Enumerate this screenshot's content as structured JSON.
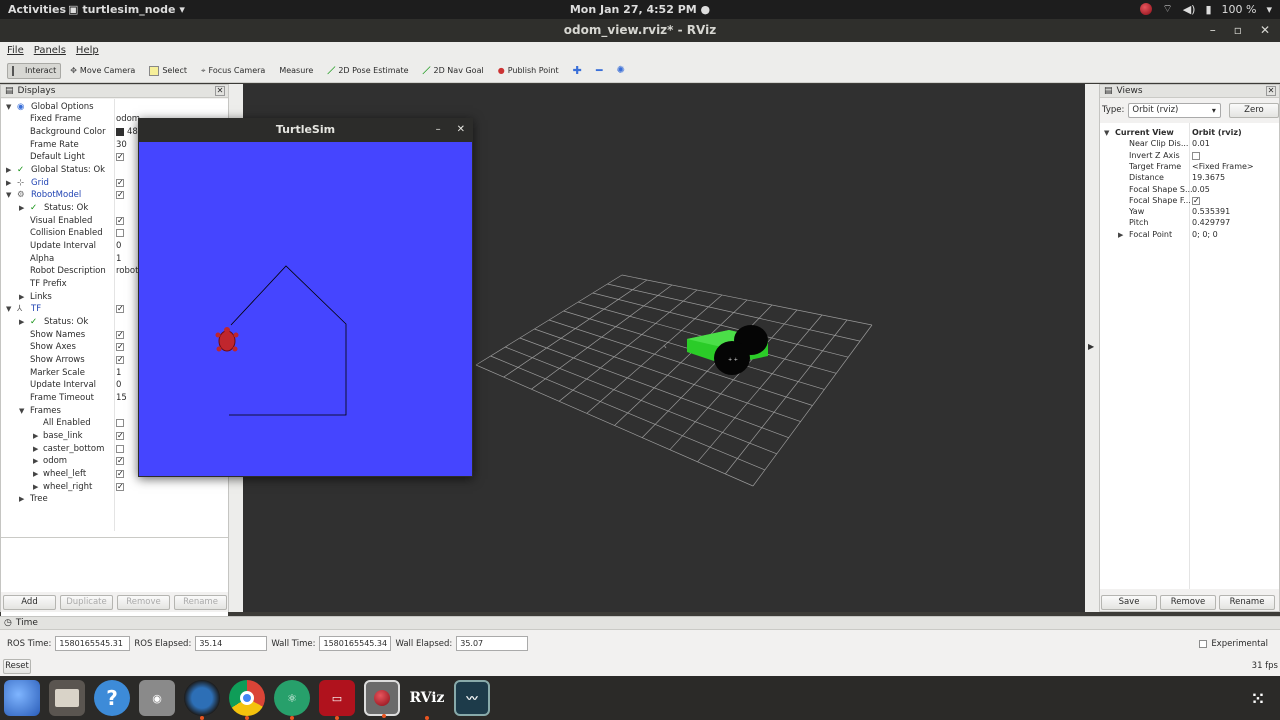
{
  "topbar": {
    "activities": "Activities",
    "app_name": "turtlesim_node",
    "clock": "Mon Jan 27,  4:52 PM",
    "battery": "100 %"
  },
  "window": {
    "title": "odom_view.rviz* - RViz"
  },
  "menu": {
    "file": "File",
    "panels": "Panels",
    "help": "Help"
  },
  "toolbar": {
    "tools": [
      {
        "label": "Interact",
        "icon": "interact-icon"
      },
      {
        "label": "Move Camera",
        "icon": "move-camera-icon"
      },
      {
        "label": "Select",
        "icon": "select-icon"
      },
      {
        "label": "Focus Camera",
        "icon": "focus-camera-icon"
      },
      {
        "label": "Measure",
        "icon": "measure-icon"
      },
      {
        "label": "2D Pose Estimate",
        "icon": "pose-estimate-icon"
      },
      {
        "label": "2D Nav Goal",
        "icon": "nav-goal-icon"
      },
      {
        "label": "Publish Point",
        "icon": "publish-point-icon"
      }
    ]
  },
  "displays": {
    "title": "Displays",
    "rows": [
      {
        "label": "Global Options"
      },
      {
        "label": "Fixed Frame",
        "value": "odom"
      },
      {
        "label": "Background Color",
        "value": "48"
      },
      {
        "label": "Frame Rate",
        "value": "30"
      },
      {
        "label": "Default Light"
      },
      {
        "label": "Global Status: Ok"
      },
      {
        "label": "Grid"
      },
      {
        "label": "RobotModel"
      },
      {
        "label": "Status: Ok"
      },
      {
        "label": "Visual Enabled"
      },
      {
        "label": "Collision Enabled"
      },
      {
        "label": "Update Interval",
        "value": "0"
      },
      {
        "label": "Alpha",
        "value": "1"
      },
      {
        "label": "Robot Description",
        "value": "robot_"
      },
      {
        "label": "TF Prefix"
      },
      {
        "label": "Links"
      },
      {
        "label": "TF"
      },
      {
        "label": "Status: Ok"
      },
      {
        "label": "Show Names"
      },
      {
        "label": "Show Axes"
      },
      {
        "label": "Show Arrows"
      },
      {
        "label": "Marker Scale",
        "value": "1"
      },
      {
        "label": "Update Interval",
        "value": "0"
      },
      {
        "label": "Frame Timeout",
        "value": "15"
      },
      {
        "label": "Frames"
      },
      {
        "label": "All Enabled"
      },
      {
        "label": "base_link"
      },
      {
        "label": "caster_bottom"
      },
      {
        "label": "odom"
      },
      {
        "label": "wheel_left"
      },
      {
        "label": "wheel_right"
      },
      {
        "label": "Tree"
      }
    ],
    "buttons": {
      "add": "Add",
      "duplicate": "Duplicate",
      "remove": "Remove",
      "rename": "Rename"
    }
  },
  "views": {
    "title": "Views",
    "type_label": "Type:",
    "type_value": "Orbit (rviz)",
    "zero": "Zero",
    "rows": [
      {
        "label": "Current View",
        "value": "Orbit (rviz)"
      },
      {
        "label": "Near Clip Dis...",
        "value": "0.01"
      },
      {
        "label": "Invert Z Axis",
        "value": ""
      },
      {
        "label": "Target Frame",
        "value": "<Fixed Frame>"
      },
      {
        "label": "Distance",
        "value": "19.3675"
      },
      {
        "label": "Focal Shape S...",
        "value": "0.05"
      },
      {
        "label": "Focal Shape F...",
        "value": ""
      },
      {
        "label": "Yaw",
        "value": "0.535391"
      },
      {
        "label": "Pitch",
        "value": "0.429797"
      },
      {
        "label": "Focal Point",
        "value": "0; 0; 0"
      }
    ],
    "buttons": {
      "save": "Save",
      "remove": "Remove",
      "rename": "Rename"
    }
  },
  "time": {
    "title": "Time",
    "ros_time_label": "ROS Time:",
    "ros_time": "1580165545.31",
    "ros_elapsed_label": "ROS Elapsed:",
    "ros_elapsed": "35.14",
    "wall_time_label": "Wall Time:",
    "wall_time": "1580165545.34",
    "wall_elapsed_label": "Wall Elapsed:",
    "wall_elapsed": "35.07",
    "experimental": "Experimental",
    "reset": "Reset",
    "fps": "31 fps"
  },
  "turtlesim": {
    "title": "TurtleSim"
  },
  "dock": {
    "rviz_label": "RViz"
  },
  "colors": {
    "turtle_bg": "#4545ff",
    "robot_body": "#22c01f",
    "view_bg": "#303030"
  }
}
